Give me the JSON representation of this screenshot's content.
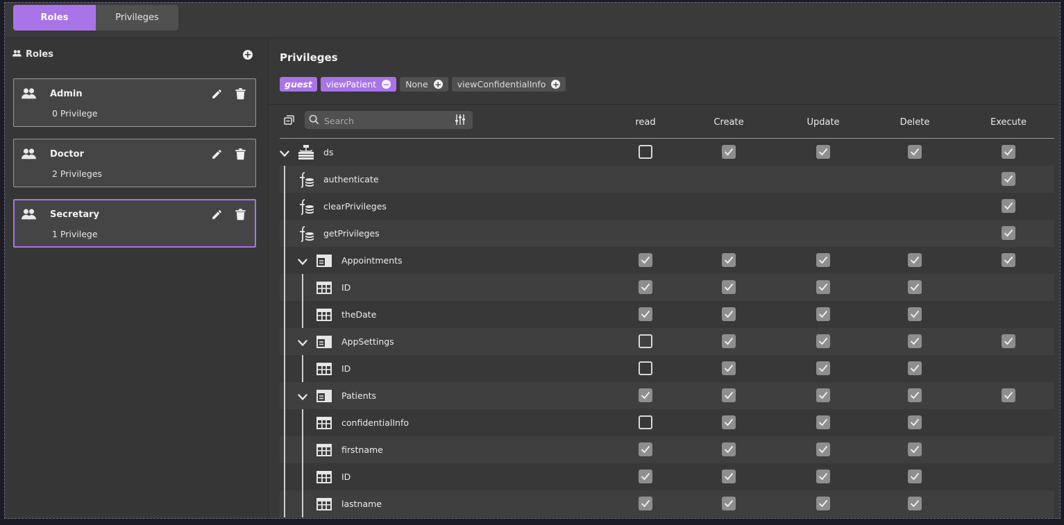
{
  "tabs": {
    "roles": "Roles",
    "privileges": "Privileges"
  },
  "roles_panel": {
    "title": "Roles",
    "roles": [
      {
        "name": "Admin",
        "count": "0 Privilege",
        "selected": false
      },
      {
        "name": "Doctor",
        "count": "2 Privileges",
        "selected": false
      },
      {
        "name": "Secretary",
        "count": "1 Privilege",
        "selected": true
      }
    ]
  },
  "privileges_panel": {
    "title": "Privileges",
    "chips": [
      {
        "label": "guest",
        "style": "guest",
        "action": ""
      },
      {
        "label": "viewPatient",
        "style": "purple",
        "action": "remove"
      },
      {
        "label": "None",
        "style": "gray",
        "action": "add"
      },
      {
        "label": "viewConfidentialInfo",
        "style": "gray",
        "action": "add"
      }
    ],
    "search_placeholder": "Search",
    "columns": [
      "read",
      "Create",
      "Update",
      "Delete",
      "Execute"
    ],
    "rows": [
      {
        "label": "ds",
        "icon": "datasource-icon",
        "level": 0,
        "expandable": true,
        "perms": [
          0,
          1,
          1,
          1,
          1
        ]
      },
      {
        "label": "authenticate",
        "icon": "function-icon",
        "level": 1,
        "expandable": false,
        "perms": [
          null,
          null,
          null,
          null,
          1
        ]
      },
      {
        "label": "clearPrivileges",
        "icon": "function-icon",
        "level": 1,
        "expandable": false,
        "perms": [
          null,
          null,
          null,
          null,
          1
        ]
      },
      {
        "label": "getPrivileges",
        "icon": "function-icon",
        "level": 1,
        "expandable": false,
        "perms": [
          null,
          null,
          null,
          null,
          1
        ]
      },
      {
        "label": "Appointments",
        "icon": "class-icon",
        "level": 1,
        "expandable": true,
        "perms": [
          1,
          1,
          1,
          1,
          1
        ]
      },
      {
        "label": "ID",
        "icon": "attribute-icon",
        "level": 2,
        "expandable": false,
        "perms": [
          1,
          1,
          1,
          1,
          null
        ]
      },
      {
        "label": "theDate",
        "icon": "attribute-icon",
        "level": 2,
        "expandable": false,
        "perms": [
          1,
          1,
          1,
          1,
          null
        ]
      },
      {
        "label": "AppSettings",
        "icon": "class-icon",
        "level": 1,
        "expandable": true,
        "perms": [
          0,
          1,
          1,
          1,
          1
        ]
      },
      {
        "label": "ID",
        "icon": "attribute-icon",
        "level": 2,
        "expandable": false,
        "perms": [
          0,
          1,
          1,
          1,
          null
        ]
      },
      {
        "label": "Patients",
        "icon": "class-icon",
        "level": 1,
        "expandable": true,
        "perms": [
          1,
          1,
          1,
          1,
          1
        ]
      },
      {
        "label": "confidentialInfo",
        "icon": "attribute-icon",
        "level": 2,
        "expandable": false,
        "perms": [
          0,
          1,
          1,
          1,
          null
        ]
      },
      {
        "label": "firstname",
        "icon": "attribute-icon",
        "level": 2,
        "expandable": false,
        "perms": [
          1,
          1,
          1,
          1,
          null
        ]
      },
      {
        "label": "ID",
        "icon": "attribute-icon",
        "level": 2,
        "expandable": false,
        "perms": [
          1,
          1,
          1,
          1,
          null
        ]
      },
      {
        "label": "lastname",
        "icon": "attribute-icon",
        "level": 2,
        "expandable": false,
        "perms": [
          1,
          1,
          1,
          1,
          null
        ]
      }
    ]
  },
  "colors": {
    "accent": "#a874e8",
    "panel": "#383838",
    "checked": "#8e8e8e"
  }
}
